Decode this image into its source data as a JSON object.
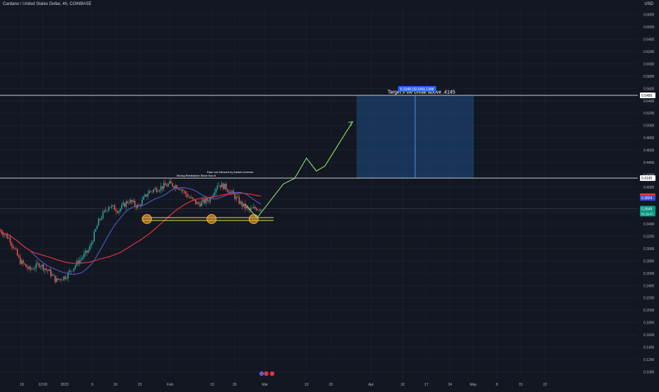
{
  "header": {
    "symbol": "Cardano / United States Dollar, 4h, COINBASE",
    "currency": "USD"
  },
  "chart_data": {
    "type": "candlestick",
    "symbol": "Cardano / United States Dollar",
    "interval": "4h",
    "exchange": "COINBASE",
    "y_axis": {
      "ticks": [
        "0.6800",
        "0.6600",
        "0.6400",
        "0.6200",
        "0.6000",
        "0.5800",
        "0.5600",
        "0.5400",
        "0.5200",
        "0.5000",
        "0.4800",
        "0.4600",
        "0.4400",
        "0.4200",
        "0.4000",
        "0.3800",
        "0.3600",
        "0.3400",
        "0.3200",
        "0.3000",
        "0.2800",
        "0.2600",
        "0.2400",
        "0.2200",
        "0.2000",
        "0.1800",
        "0.1600",
        "0.1400",
        "0.1200",
        "0.1000"
      ],
      "ylim": [
        0.09,
        0.69
      ]
    },
    "x_axis": {
      "ticks": [
        "19",
        "12:00",
        "2023",
        "9",
        "16",
        "23",
        "Feb",
        "13",
        "20",
        "Mar",
        "13",
        "20",
        "Apr",
        "10",
        "17",
        "24",
        "May",
        "8",
        "15",
        "22"
      ]
    },
    "price_labels": [
      {
        "value": 0.5489,
        "text": "0.5489",
        "style": "white"
      },
      {
        "value": 0.4145,
        "text": "0.4145",
        "style": "white"
      },
      {
        "value": 0.385,
        "text": "0.3850",
        "style": "red"
      },
      {
        "value": 0.3824,
        "text": "0.3824",
        "style": "blue"
      },
      {
        "value": 0.3649,
        "text": "0.3649",
        "sub": "01:15:47",
        "style": "green"
      }
    ],
    "horizontal_lines": [
      0.5489,
      0.4145
    ],
    "current_price": 0.3649,
    "support_price": 0.348,
    "annotations": {
      "fakeout": "Fake out followed by instant reversal.",
      "resistance": "Strong Resistance Since Nov 8",
      "target": "Target if we break above .4145",
      "measure": "0.1348 (32.545) 1348"
    },
    "projection_path": [
      {
        "x": 0.372,
        "y": 0.372
      },
      {
        "x": 0.39,
        "y": 0.35
      },
      {
        "x": 0.43,
        "y": 0.405
      },
      {
        "x": 0.447,
        "y": 0.414
      },
      {
        "x": 0.465,
        "y": 0.447
      },
      {
        "x": 0.48,
        "y": 0.426
      },
      {
        "x": 0.493,
        "y": 0.434
      },
      {
        "x": 0.535,
        "y": 0.506
      }
    ],
    "events": [
      "marker-1",
      "flag-us",
      "flag-us"
    ],
    "colors": {
      "background": "#131722",
      "up": "#26a69a",
      "down": "#ef5350",
      "ma_fast": "#5b5fd8",
      "ma_slow": "#e0323f",
      "projection": "#8fe06b",
      "support": "#e8e63a",
      "target_box": "#1e4e86",
      "level_line": "#c8ccd6"
    }
  }
}
